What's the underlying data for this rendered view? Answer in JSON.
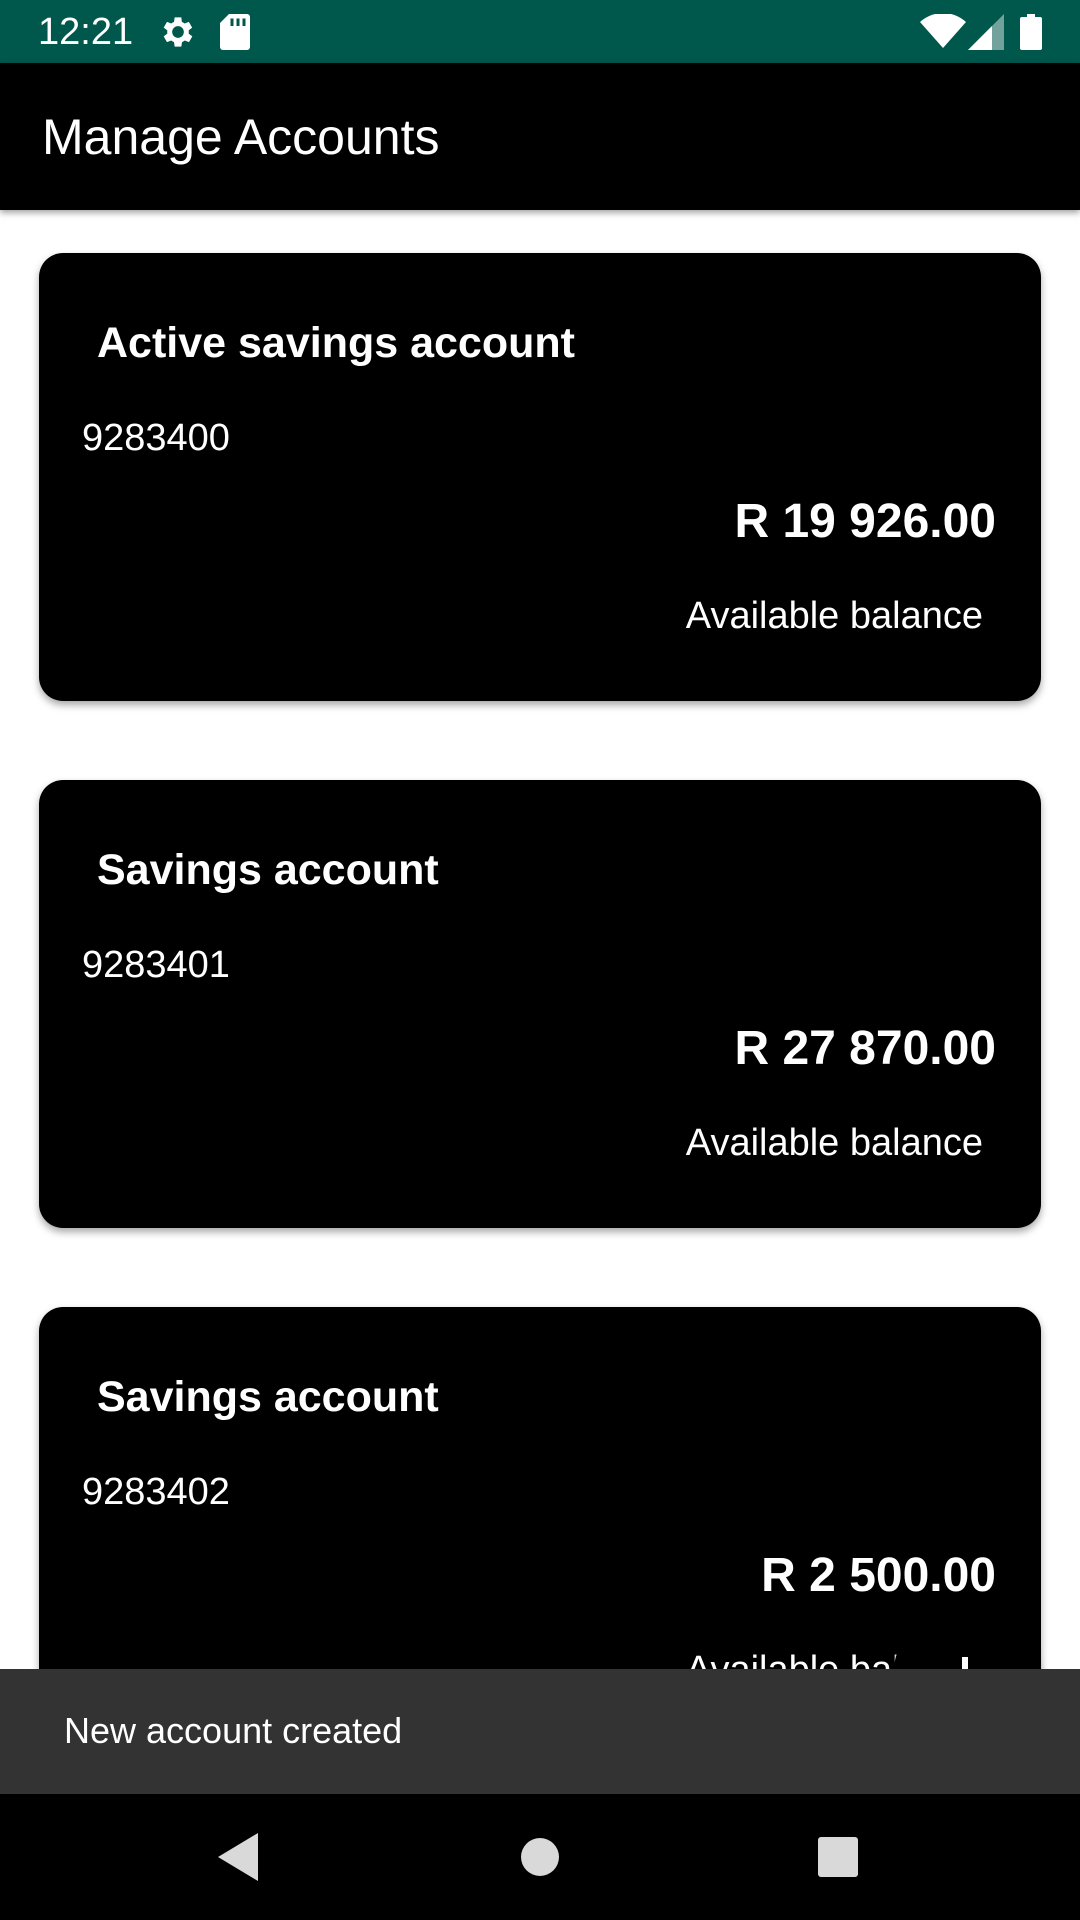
{
  "status_bar": {
    "time": "12:21",
    "background_color": "#00574b",
    "icons": [
      "gear-icon",
      "sd-card-icon",
      "wifi-icon",
      "signal-icon",
      "battery-icon"
    ]
  },
  "app_bar": {
    "title": "Manage Accounts",
    "background_color": "#000000"
  },
  "accounts": [
    {
      "name": "Active savings account",
      "number": "9283400",
      "balance": "R 19 926.00",
      "balance_label": "Available balance"
    },
    {
      "name": "Savings account",
      "number": "9283401",
      "balance": "R 27 870.00",
      "balance_label": "Available balance"
    },
    {
      "name": "Savings account",
      "number": "9283402",
      "balance": "R 2 500.00",
      "balance_label": "Available balance"
    }
  ],
  "fab": {
    "icon": "plus-icon"
  },
  "snackbar": {
    "message": "New account created"
  },
  "nav_bar": {
    "icons": [
      "back-icon",
      "home-icon",
      "recents-icon"
    ]
  }
}
